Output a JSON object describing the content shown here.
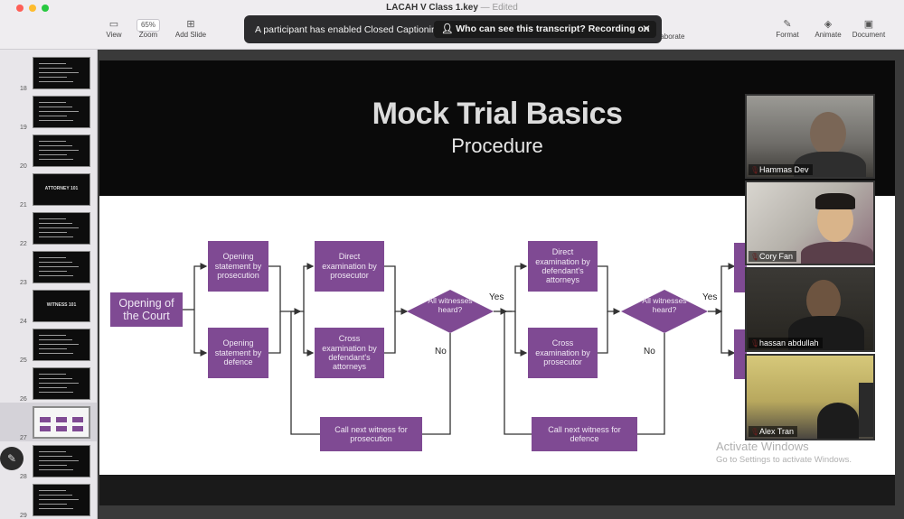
{
  "window": {
    "title": "LACAH V Class 1.key",
    "status": "Edited",
    "traffic_colors": [
      "#fe5f57",
      "#febc2e",
      "#28c840"
    ]
  },
  "toolbar": {
    "view": "View",
    "zoom_value": "65%",
    "zoom": "Zoom",
    "add_slide": "Add Slide",
    "collaborate": "laborate",
    "format": "Format",
    "animate": "Animate",
    "document": "Document"
  },
  "notification": {
    "text": "A participant has enabled Closed Captioning",
    "action": "Who can see this transcript? Recording on",
    "close": "✕"
  },
  "sidebar": {
    "slides": [
      {
        "num": "18"
      },
      {
        "num": "19"
      },
      {
        "num": "20"
      },
      {
        "num": "21",
        "label": "ATTORNEY 101"
      },
      {
        "num": "22"
      },
      {
        "num": "23"
      },
      {
        "num": "24",
        "label": "WITNESS 101"
      },
      {
        "num": "25"
      },
      {
        "num": "26"
      },
      {
        "num": "27",
        "selected": true
      },
      {
        "num": "28"
      },
      {
        "num": "29"
      }
    ]
  },
  "slide": {
    "title": "Mock Trial Basics",
    "subtitle": "Procedure",
    "accent_color": "#7f4a93",
    "flow": {
      "opening_court": "Opening of the Court",
      "opening_prosecution": "Opening statement by prosecution",
      "opening_defence": "Opening statement by defence",
      "direct_prosecutor": "Direct examination by prosecutor",
      "cross_defendant": "Cross examination by defendant's attorneys",
      "all_witnesses_1": "All witnesses heard?",
      "call_next_prosecution": "Call next witness for prosecution",
      "yes_1": "Yes",
      "no_1": "No",
      "direct_defendant": "Direct examination by defendant's attorneys",
      "cross_prosecutor": "Cross examination by prosecutor",
      "all_witnesses_2": "All witnesses heard?",
      "call_next_defence": "Call next witness for defence",
      "yes_2": "Yes",
      "no_2": "No"
    }
  },
  "watermark": {
    "title": "Activate Windows",
    "subtitle": "Go to Settings to activate Windows."
  },
  "participants": [
    {
      "name": "Hammas Dev"
    },
    {
      "name": "Cory Fan"
    },
    {
      "name": "hassan abdullah"
    },
    {
      "name": "Alex Tran"
    }
  ]
}
